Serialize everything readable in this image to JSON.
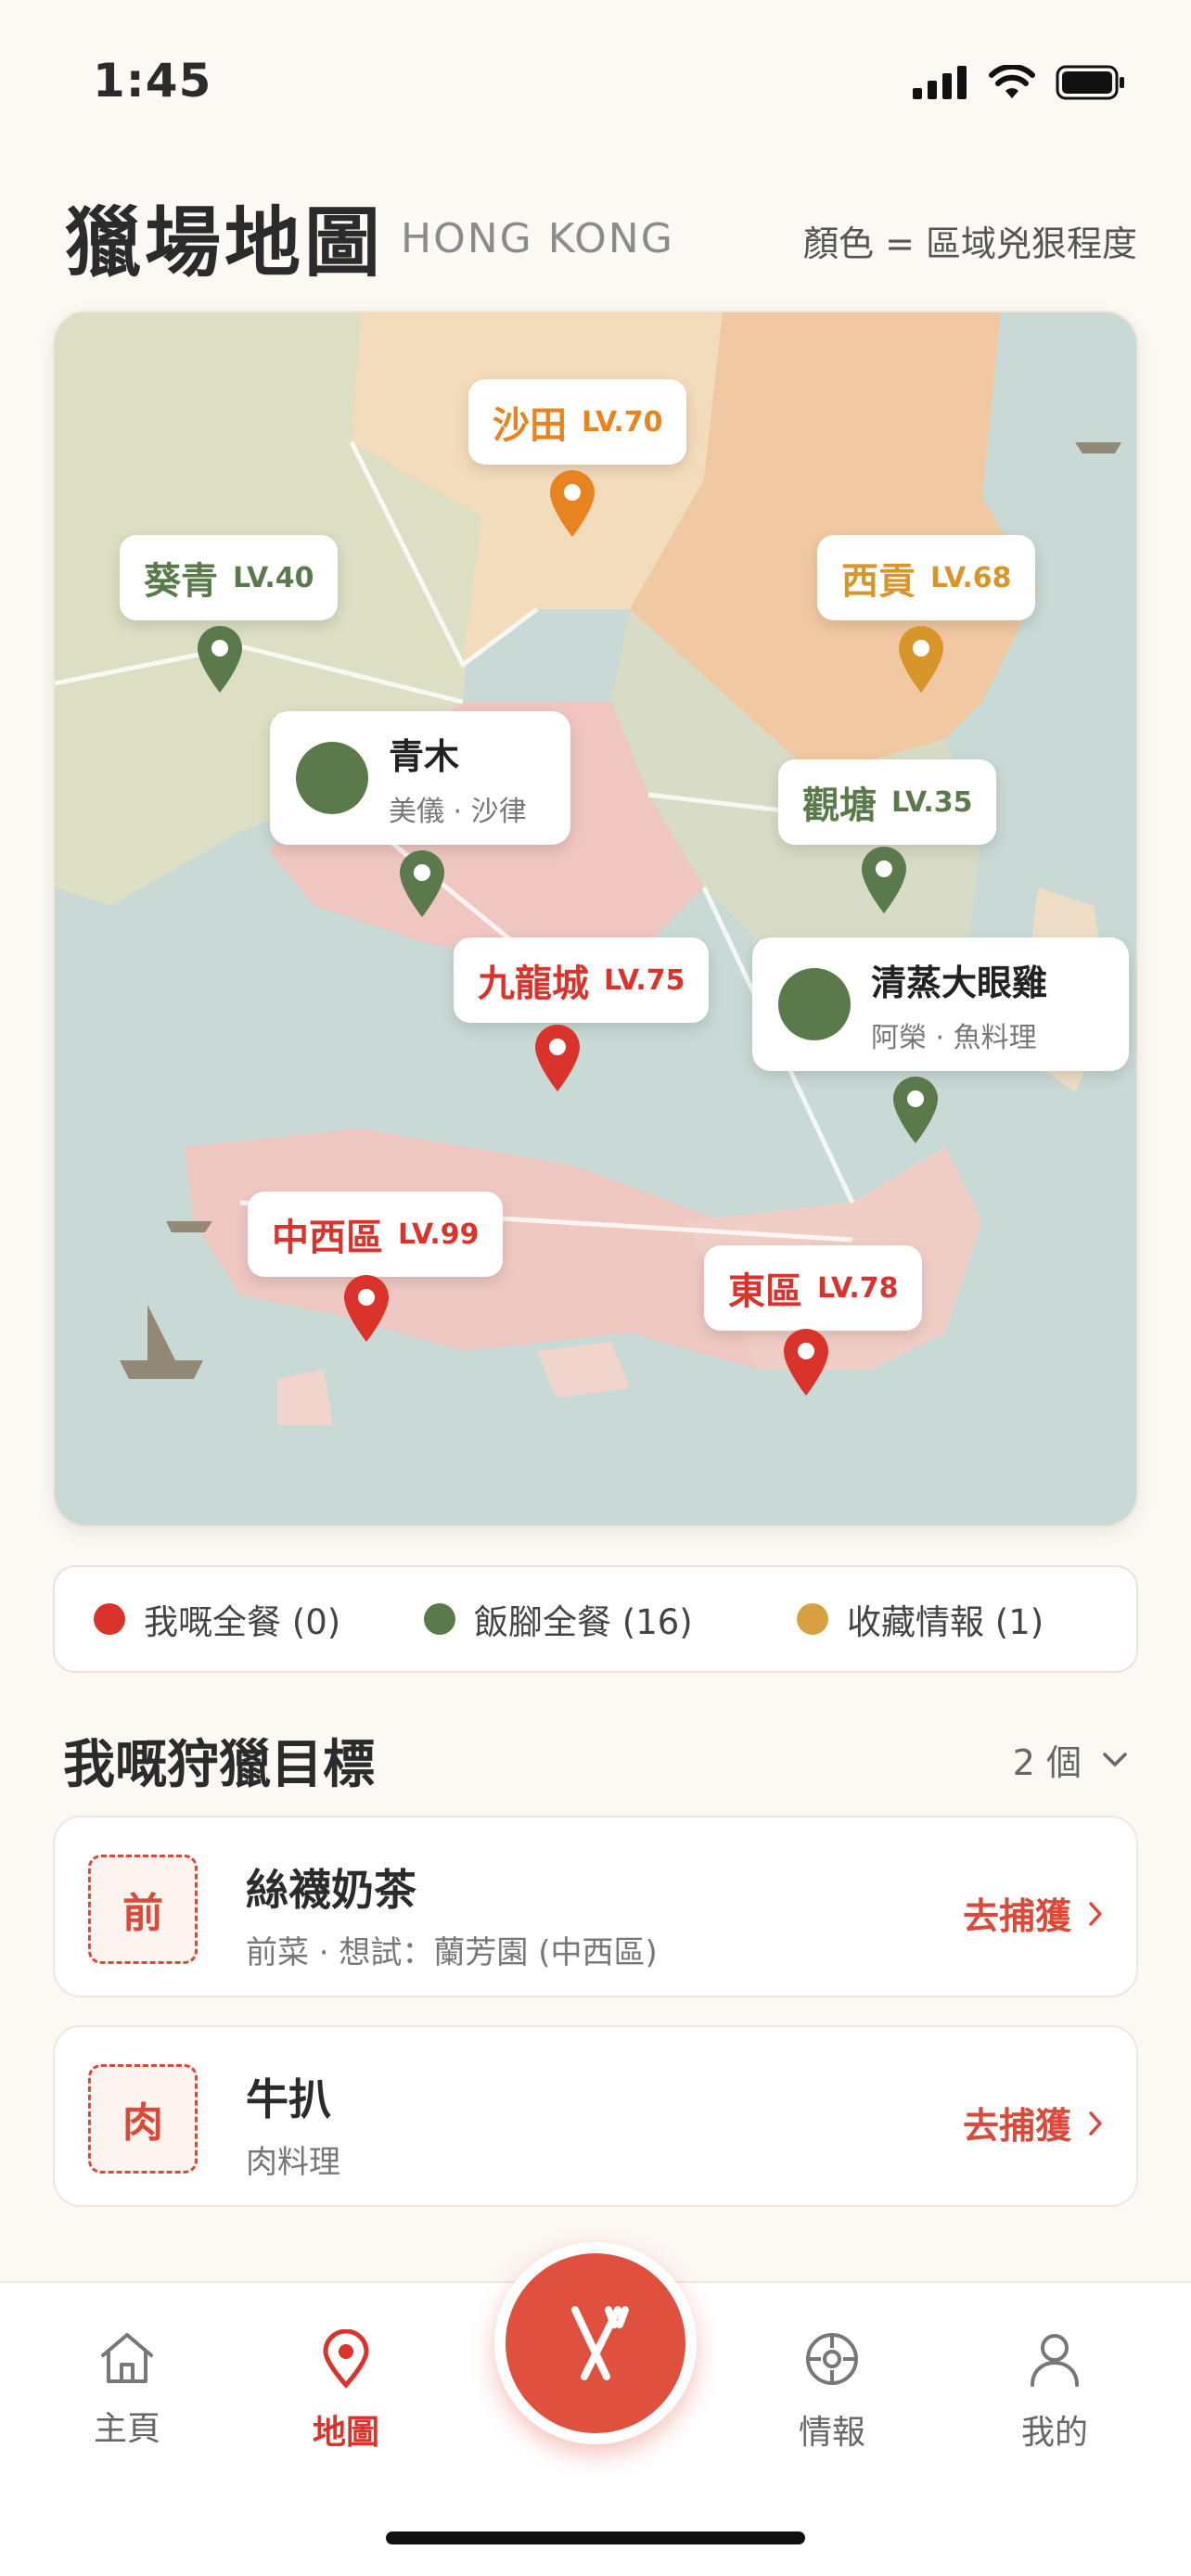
{
  "status": {
    "time": "1:45"
  },
  "header": {
    "title": "獵場地圖",
    "subtitle": "HONG KONG",
    "legend_note": "顏色 = 區域兇狠程度"
  },
  "map": {
    "regions": [
      {
        "name": "沙田",
        "level": "LV.70",
        "color": "#e8841f"
      },
      {
        "name": "葵青",
        "level": "LV.40",
        "color": "#5b7a4b"
      },
      {
        "name": "西貢",
        "level": "LV.68",
        "color": "#d8962a"
      },
      {
        "name": "觀塘",
        "level": "LV.35",
        "color": "#5b7a4b"
      },
      {
        "name": "九龍城",
        "level": "LV.75",
        "color": "#d9332b"
      },
      {
        "name": "中西區",
        "level": "LV.99",
        "color": "#d9332b"
      },
      {
        "name": "東區",
        "level": "LV.78",
        "color": "#d9332b"
      }
    ],
    "restaurants": [
      {
        "name": "青木",
        "sub": "美儀 · 沙律"
      },
      {
        "name": "清蒸大眼雞",
        "sub": "阿榮 · 魚料理"
      }
    ]
  },
  "legend": [
    {
      "label": "我嘅全餐 (0)",
      "color": "#d9332b"
    },
    {
      "label": "飯腳全餐 (16)",
      "color": "#5b7a4b"
    },
    {
      "label": "收藏情報 (1)",
      "color": "#d8a040"
    }
  ],
  "targets": {
    "title": "我嘅狩獵目標",
    "count": "2 個",
    "items": [
      {
        "badge": "前",
        "name": "絲襪奶茶",
        "sub": "前菜 · 想試：蘭芳園 (中西區)",
        "action": "去捕獲"
      },
      {
        "badge": "肉",
        "name": "牛扒",
        "sub": "肉料理",
        "action": "去捕獲"
      }
    ]
  },
  "tabs": [
    {
      "label": "主頁",
      "icon": "home-icon"
    },
    {
      "label": "地圖",
      "icon": "map-pin-icon"
    },
    {
      "label": "情報",
      "icon": "compass-icon"
    },
    {
      "label": "我的",
      "icon": "profile-icon"
    }
  ],
  "colors": {
    "accent": "#e0503e"
  }
}
